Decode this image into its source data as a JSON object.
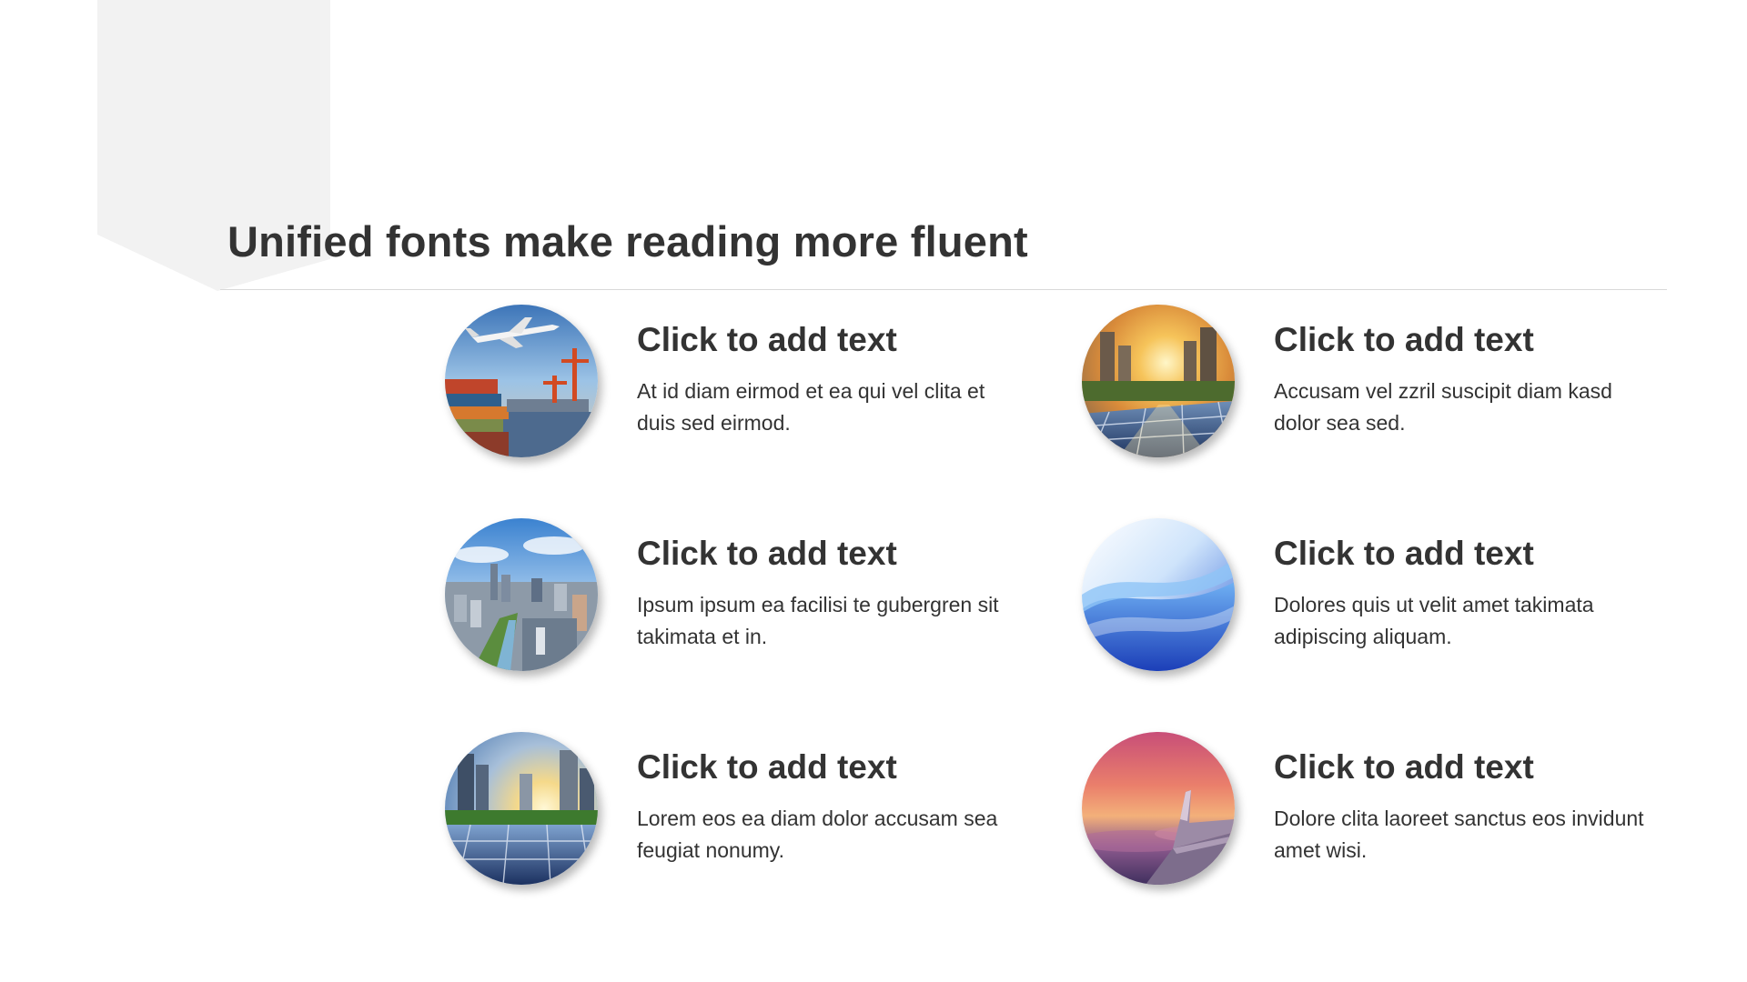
{
  "slide": {
    "title": "Unified fonts make reading more fluent"
  },
  "items": [
    {
      "heading": "Click to add text",
      "body": "At id diam eirmod et ea qui vel clita et duis sed eirmod.",
      "image": "airplane-over-cargo-port"
    },
    {
      "heading": "Click to add text",
      "body": "Accusam vel zzril suscipit diam kasd dolor sea sed.",
      "image": "sunset-city-with-solar-panels"
    },
    {
      "heading": "Click to add text",
      "body": "Ipsum ipsum ea facilisi te gubergren sit takimata et in.",
      "image": "city-skyline-aerial"
    },
    {
      "heading": "Click to add text",
      "body": "Dolores quis ut velit amet takimata adipiscing aliquam.",
      "image": "blue-abstract-wave"
    },
    {
      "heading": "Click to add text",
      "body": "Lorem eos ea diam dolor accusam sea feugiat nonumy.",
      "image": "solar-panels-and-skyscrapers"
    },
    {
      "heading": "Click to add text",
      "body": "Dolore clita laoreet sanctus eos invidunt amet wisi.",
      "image": "airplane-wing-at-sunset"
    }
  ],
  "colors": {
    "text": "#333333",
    "rule": "#d9d9d9",
    "corner_tab": "#f2f2f2"
  }
}
